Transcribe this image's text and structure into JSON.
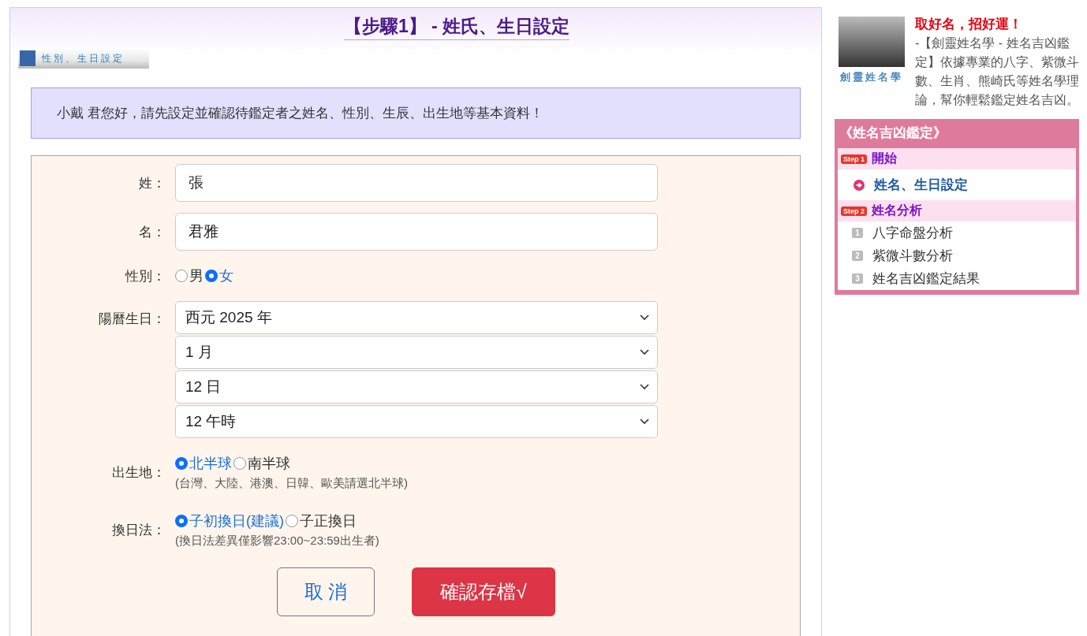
{
  "main": {
    "heading": "【步驟1】 - 姓氏、生日設定",
    "banner": "性別、生日設定",
    "notice": "小戴 君您好，請先設定並確認待鑑定者之姓名、性別、生辰、出生地等基本資料！",
    "form": [
      {
        "kind": "text",
        "label": "姓：",
        "value": "張"
      },
      {
        "kind": "text",
        "label": "名：",
        "value": "君雅"
      },
      {
        "kind": "radio",
        "label": "性別：",
        "options": [
          {
            "label": "男",
            "selected": false
          },
          {
            "label": "女",
            "selected": true
          }
        ]
      },
      {
        "kind": "select",
        "label": "陽曆生日：",
        "selects": [
          "西元 2025 年",
          "1 月",
          "12 日",
          "12 午時"
        ]
      },
      {
        "kind": "radio",
        "label": "出生地：",
        "options": [
          {
            "label": "北半球",
            "selected": true
          },
          {
            "label": "南半球",
            "selected": false
          }
        ],
        "hint": "(台灣、大陸、港澳、日韓、歐美請選北半球)"
      },
      {
        "kind": "radio",
        "label": "換日法：",
        "options": [
          {
            "label": "子初換日(建議)",
            "selected": true
          },
          {
            "label": "子正換日",
            "selected": false
          }
        ],
        "hint": "(換日法差異僅影響23:00~23:59出生者)"
      }
    ],
    "buttons": [
      {
        "kind": "cancel",
        "label": "取 消"
      },
      {
        "kind": "submit",
        "label": "確認存檔√"
      }
    ]
  },
  "sidebar": {
    "logo_text": "劍靈姓名學",
    "promo_title": "取好名，招好運！",
    "promo_text": "-【劍靈姓名學 - 姓名吉凶鑑定】依據專業的八字、紫微斗數、生肖、熊崎氏等姓名學理論，幫你輕鬆鑑定姓名吉凶。",
    "menu": {
      "title": "《姓名吉凶鑑定》",
      "steps": [
        {
          "badge": "Step 1",
          "title": "開始",
          "items": [
            {
              "marker": "",
              "label": "姓名、生日設定",
              "selected": true
            }
          ]
        },
        {
          "badge": "Step 2",
          "title": "姓名分析",
          "items": [
            {
              "marker": "1",
              "label": "八字命盤分析",
              "selected": false
            },
            {
              "marker": "2",
              "label": "紫微斗數分析",
              "selected": false
            },
            {
              "marker": "3",
              "label": "姓名吉凶鑑定結果",
              "selected": false
            }
          ]
        }
      ]
    }
  }
}
